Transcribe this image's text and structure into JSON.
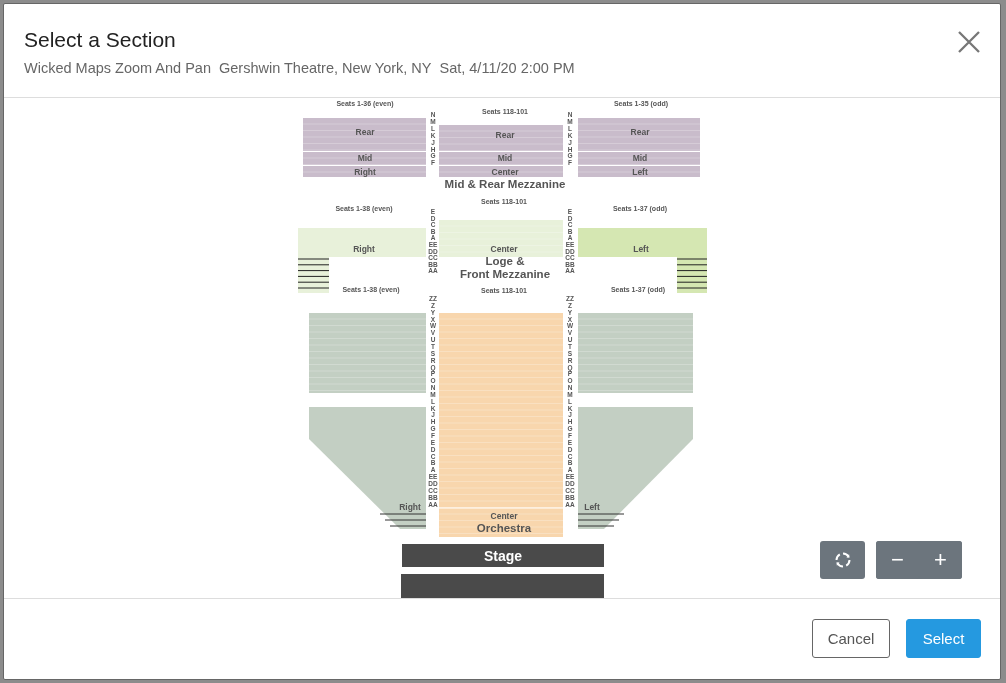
{
  "dialog": {
    "title": "Select a Section",
    "subtitle": [
      "Wicked Maps Zoom And Pan",
      "Gershwin Theatre, New York, NY",
      "Sat, 4/11/20 2:00 PM"
    ]
  },
  "map": {
    "levels": [
      {
        "title": [
          "Mid & Rear Mezzanine"
        ],
        "seat_labels": [
          "Seats 1-36 (even)",
          "Seats 118-101",
          "Seats 1-35 (odd)"
        ],
        "aisles": [
          {
            "rows": [
              "N",
              "M",
              "L",
              "K",
              "J",
              "H",
              "G",
              "F"
            ]
          },
          {
            "rows": [
              "N",
              "M",
              "L",
              "K",
              "J",
              "H",
              "G",
              "F"
            ]
          }
        ],
        "sections": [
          {
            "label": "Rear",
            "color": "#c9bccb"
          },
          {
            "label": "Mid",
            "color": "#c9bccb"
          },
          {
            "label": "Right",
            "color": "#c9bccb"
          },
          {
            "label": "Rear",
            "color": "#c9bccb"
          },
          {
            "label": "Mid",
            "color": "#c9bccb"
          },
          {
            "label": "Center",
            "color": "#c9bccb"
          },
          {
            "label": "Rear",
            "color": "#c9bccb"
          },
          {
            "label": "Mid",
            "color": "#c9bccb"
          },
          {
            "label": "Left",
            "color": "#c9bccb"
          }
        ]
      },
      {
        "title": [
          "Loge &",
          "Front Mezzanine"
        ],
        "seat_labels": [
          "Seats 1-38 (even)",
          "Seats 118-101",
          "Seats 1-37 (odd)"
        ],
        "aisles": [
          {
            "rows": [
              "E",
              "D",
              "C",
              "B",
              "A",
              "EE",
              "DD",
              "CC",
              "BB",
              "AA"
            ]
          },
          {
            "rows": [
              "E",
              "D",
              "C",
              "B",
              "A",
              "EE",
              "DD",
              "CC",
              "BB",
              "AA"
            ]
          }
        ],
        "sections": [
          {
            "label": "Right",
            "color": "#e8f1da"
          },
          {
            "label": "Center",
            "color": "#e8f1da"
          },
          {
            "label": "Left",
            "color": "#d5e7b2"
          }
        ]
      },
      {
        "title": [
          "Orchestra"
        ],
        "seat_labels": [
          "Seats 1-38 (even)",
          "Seats 118-101",
          "Seats 1-37 (odd)"
        ],
        "aisles": [
          {
            "rows": [
              "ZZ",
              "Z",
              "Y",
              "X",
              "W",
              "V",
              "U",
              "T",
              "S",
              "R",
              "Q",
              "P",
              "O",
              "N",
              "M",
              "L",
              "K",
              "J",
              "H",
              "G",
              "F",
              "E",
              "D",
              "C",
              "B",
              "A",
              "EE",
              "DD",
              "CC",
              "BB",
              "AA"
            ]
          },
          {
            "rows": [
              "ZZ",
              "Z",
              "Y",
              "X",
              "W",
              "V",
              "U",
              "T",
              "S",
              "R",
              "Q",
              "P",
              "O",
              "N",
              "M",
              "L",
              "K",
              "J",
              "H",
              "G",
              "F",
              "E",
              "D",
              "C",
              "B",
              "A",
              "EE",
              "DD",
              "CC",
              "BB",
              "AA"
            ]
          }
        ],
        "sections": [
          {
            "color": "#c3cfc3"
          },
          {
            "label": "Right",
            "color": "#c3cfc3"
          },
          {
            "label": "Center",
            "color": "#f8d6ad"
          },
          {
            "color": "#c3cfc3"
          },
          {
            "label": "Left",
            "color": "#c3cfc3"
          }
        ]
      }
    ],
    "stage": {
      "label": "Stage"
    }
  },
  "zoom_controls": {
    "out": "−",
    "in": "+"
  },
  "buttons": [
    {
      "label": "Cancel",
      "kind": "secondary"
    },
    {
      "label": "Select",
      "kind": "primary"
    }
  ]
}
